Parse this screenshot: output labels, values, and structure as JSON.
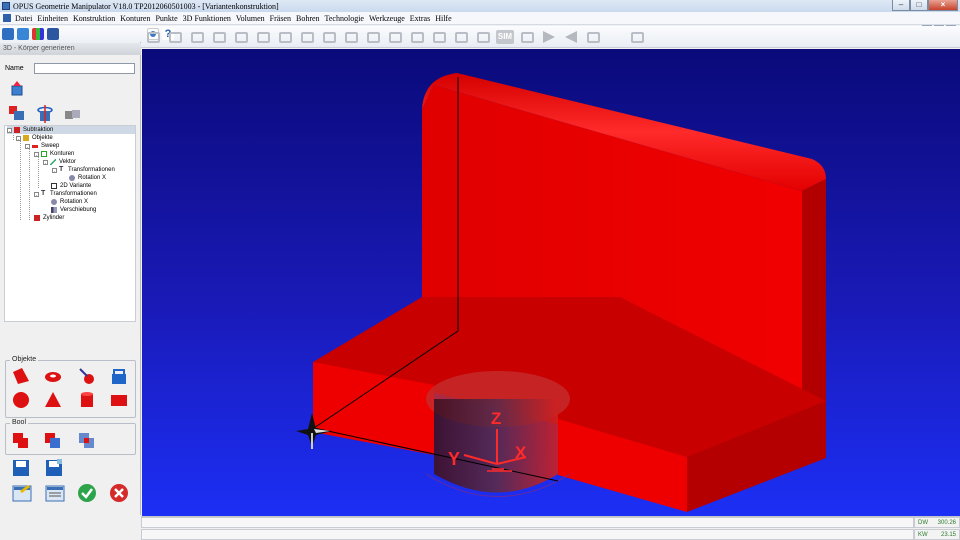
{
  "window": {
    "title": "OPUS Geometrie Manipulator V18.0    TP2012060501003    - [Variantenkonstruktion]"
  },
  "menu": {
    "items": [
      "Datei",
      "Einheiten",
      "Konstruktion",
      "Konturen",
      "Punkte",
      "3D Funktionen",
      "Volumen",
      "Fräsen",
      "Bohren",
      "Technologie",
      "Werkzeuge",
      "Extras",
      "Hilfe"
    ]
  },
  "toolbar": {
    "sim_label": "SIM"
  },
  "panel": {
    "header": "3D - Körper generieren",
    "name_label": "Name",
    "name_value": "",
    "tree": [
      {
        "label": "Subtraktion",
        "level": 0,
        "icon": "subtract-icon",
        "selected": true
      },
      {
        "label": "Objekte",
        "level": 1,
        "icon": "objects-icon"
      },
      {
        "label": "Sweep",
        "level": 2,
        "icon": "sweep-icon"
      },
      {
        "label": "Konturen",
        "level": 3,
        "icon": "contour-icon"
      },
      {
        "label": "Vektor",
        "level": 4,
        "icon": "vector-icon"
      },
      {
        "label": "Transformationen",
        "level": 5,
        "icon": "transform-icon"
      },
      {
        "label": "Rotation X",
        "level": 6,
        "icon": "rotation-icon"
      },
      {
        "label": "2D Variante",
        "level": 3,
        "icon": "variant-icon"
      },
      {
        "label": "Transformationen",
        "level": 2,
        "icon": "transform-icon"
      },
      {
        "label": "Rotation X",
        "level": 3,
        "icon": "rotation-icon"
      },
      {
        "label": "Verschiebung",
        "level": 3,
        "icon": "translate-icon"
      },
      {
        "label": "Zylinder",
        "level": 1,
        "icon": "cylinder-icon"
      }
    ],
    "objekte_label": "Objekte",
    "bool_label": "Bool"
  },
  "viewport": {
    "axis_labels": {
      "z": "Z",
      "y": "Y",
      "x": "X"
    }
  },
  "status": {
    "dw_label": "DW",
    "dw_value": "300.26",
    "kw_label": "KW",
    "kw_value": "23.15"
  },
  "colors": {
    "model_red": "#ff0000",
    "viewport_blue": "#1010a0"
  }
}
